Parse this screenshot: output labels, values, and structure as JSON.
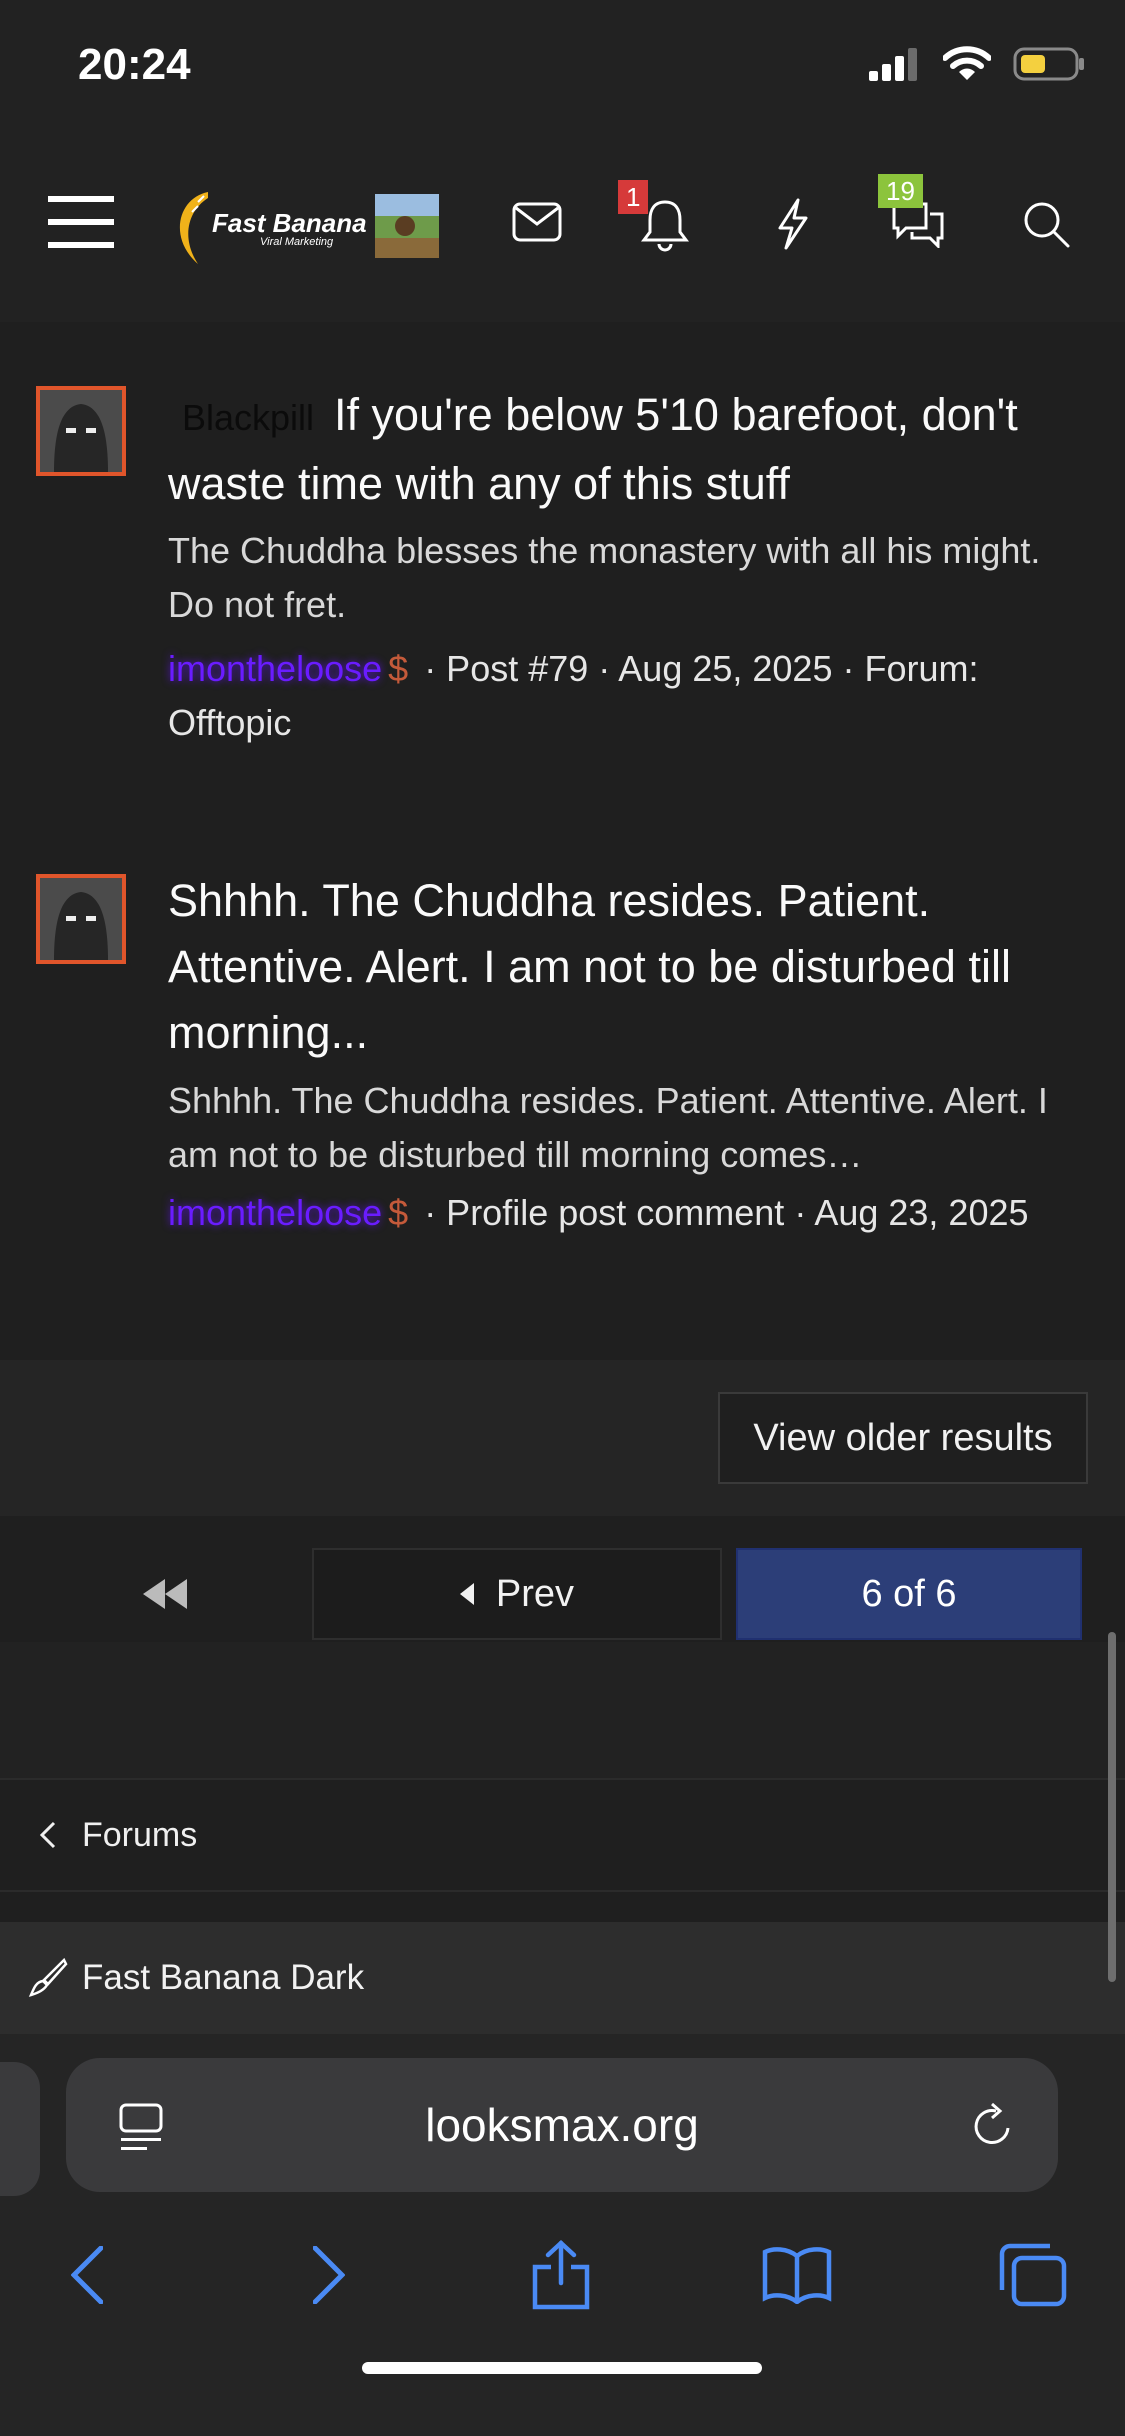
{
  "status": {
    "time": "20:24"
  },
  "nav": {
    "alerts_count": "1",
    "conversations_count": "19",
    "logo_text": "Fast Banana",
    "logo_sub": "Viral Marketing"
  },
  "results": [
    {
      "prefix": "Blackpill",
      "title": "If you're below 5'10 barefoot, don't waste time with any of this stuff",
      "snippet": "The Chuddha blesses the monastery with all his might. Do not fret.",
      "user": "imontheloose",
      "dollar": "$",
      "meta": "· Post #79 · Aug 25, 2025 · Forum: Offtopic"
    },
    {
      "title": "Shhhh. The Chuddha resides. Patient. Attentive. Alert. I am not to be disturbed till morning...",
      "snippet": "Shhhh. The Chuddha resides. Patient. Attentive. Alert. I am not to be disturbed till morning comes…",
      "user": "imontheloose",
      "dollar": "$",
      "meta": "· Profile post comment · Aug 23, 2025"
    }
  ],
  "older_button": "View older results",
  "pagination": {
    "prev": "Prev",
    "current": "6 of 6"
  },
  "breadcrumb": {
    "label": "Forums"
  },
  "style_chooser": {
    "label": "Fast Banana Dark"
  },
  "browser": {
    "url": "looksmax.org"
  },
  "colors": {
    "accent": "#2c3e78",
    "username": "#6a1cff",
    "avatar_border": "#e0552b",
    "alert_badge": "#d63a3a",
    "conv_badge": "#8cc43c",
    "safari_blue": "#4a8af4"
  }
}
